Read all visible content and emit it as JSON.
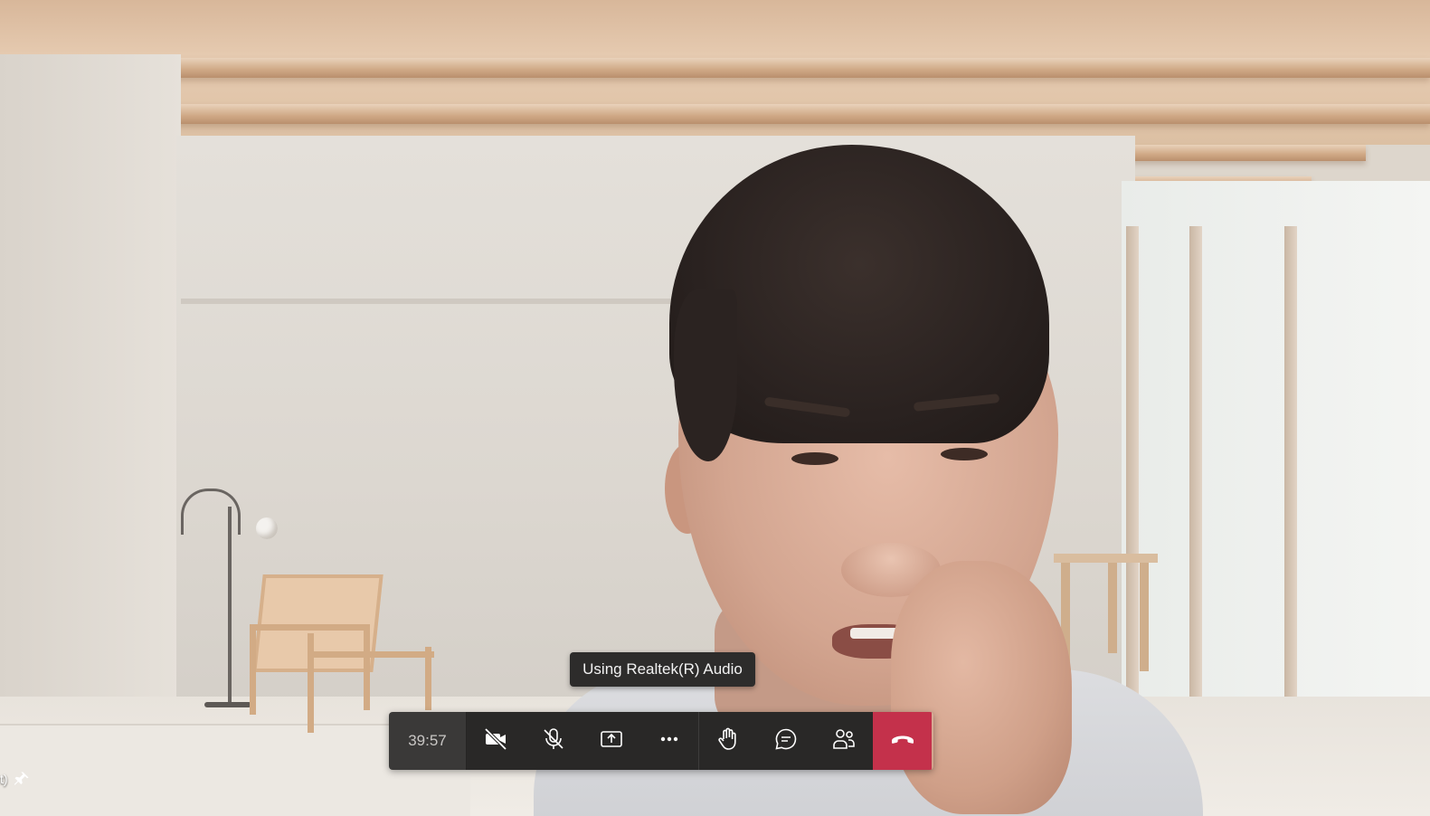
{
  "call": {
    "timer": "39:57",
    "tooltip": "Using Realtek(R) Audio",
    "participant_label_fragment": "t)"
  },
  "controls": {
    "camera_icon": "camera-off-icon",
    "mic_icon": "mic-off-icon",
    "share_icon": "share-screen-icon",
    "more_icon": "more-options-icon",
    "raise_hand_icon": "raise-hand-icon",
    "chat_icon": "chat-icon",
    "participants_icon": "participants-icon",
    "hangup_icon": "hang-up-icon"
  },
  "colors": {
    "toolbar_bg": "#292827",
    "timer_bg": "#3a3938",
    "hangup": "#c4314b",
    "icon": "#ffffff"
  }
}
